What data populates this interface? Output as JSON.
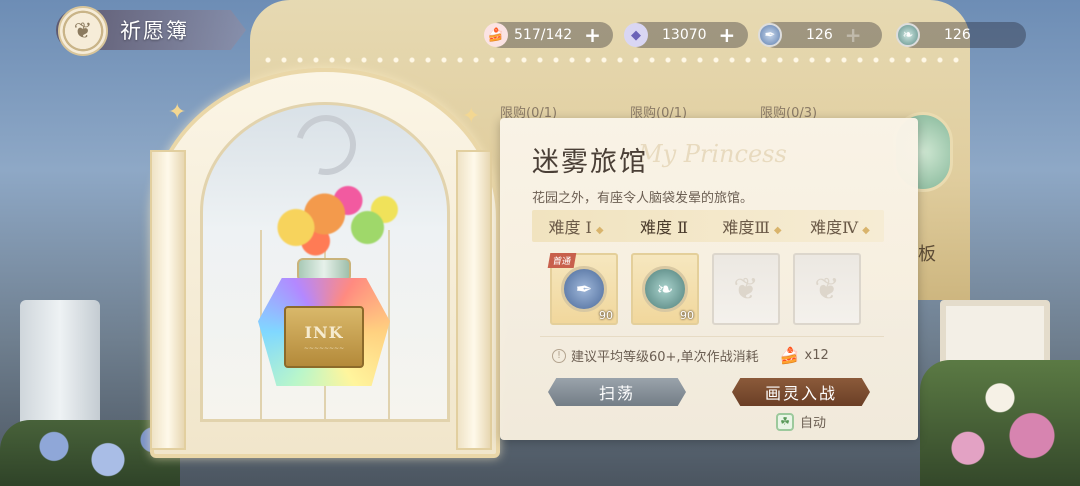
{
  "header": {
    "title": "祈愿簿",
    "emblem_icon": "butterfly-icon"
  },
  "resources": [
    {
      "icon": "cake-icon",
      "value": "517/142",
      "plus": true
    },
    {
      "icon": "diamond-icon",
      "value": "13070",
      "plus": true
    },
    {
      "icon": "feather-token-icon",
      "value": "126",
      "plus": false
    },
    {
      "icon": "leaf-token-icon",
      "value": "126",
      "plus": false
    }
  ],
  "background": {
    "limits": [
      "限购(0/1)",
      "限购(0/1)",
      "限购(0/3)"
    ],
    "board_char": "板"
  },
  "stage": {
    "title": "迷雾旅馆",
    "watermark": "My Princess",
    "description": "花园之外，有座令人脑袋发晕的旅馆。",
    "difficulties": [
      "难度 Ⅰ",
      "难度 Ⅱ",
      "难度Ⅲ",
      "难度Ⅳ"
    ],
    "active_difficulty_index": 1,
    "rewards": [
      {
        "type": "blue-feather-orb",
        "qty": "90",
        "badge": "首通"
      },
      {
        "type": "teal-leaf-orb",
        "qty": "90",
        "badge": ""
      },
      {
        "type": "empty",
        "qty": "",
        "badge": ""
      },
      {
        "type": "empty",
        "qty": "",
        "badge": ""
      }
    ],
    "tip": "建议平均等级60+,单次作战消耗",
    "cost": "x12",
    "sweep_label": "扫荡",
    "battle_label": "画灵入战",
    "auto_label": "自动"
  },
  "artwork": {
    "bottle_label": "INK"
  },
  "colors": {
    "accent_brown": "#6b3f26",
    "sweep_gray": "#737d86",
    "card_bg": "#faf4e8"
  }
}
